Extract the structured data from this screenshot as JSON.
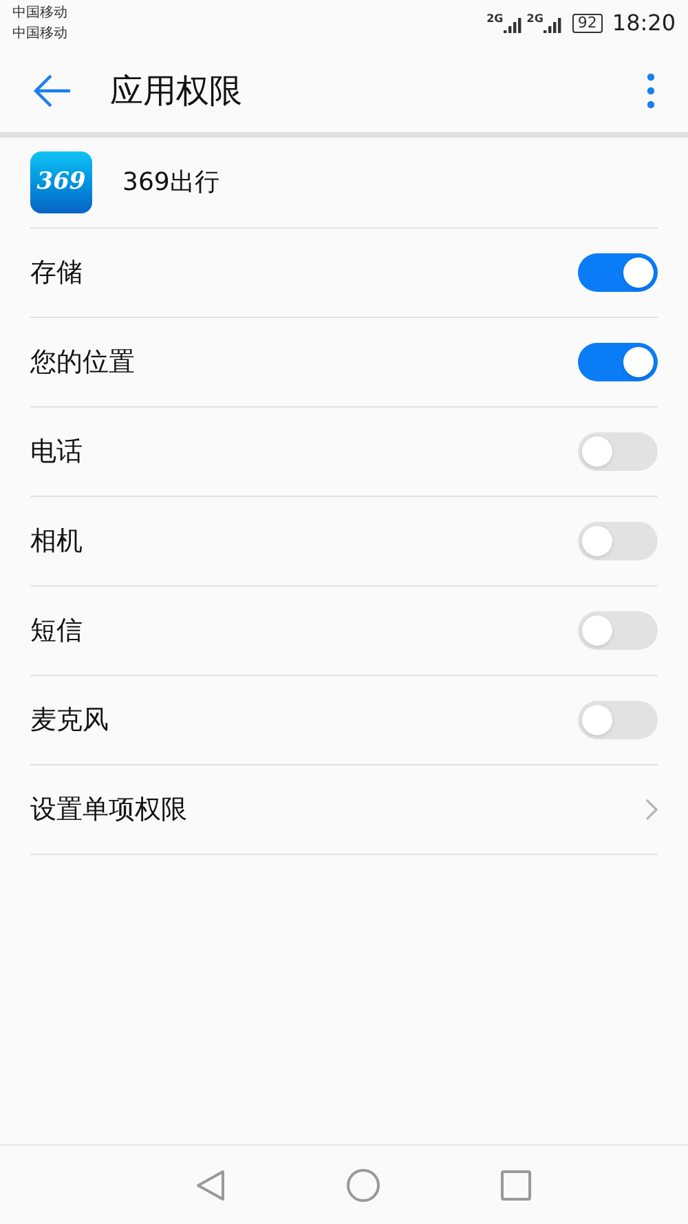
{
  "status_bar": {
    "carriers": [
      "中国移动",
      "中国移动"
    ],
    "network_labels": [
      "2G",
      "2G"
    ],
    "battery": "92",
    "time": "18:20"
  },
  "header": {
    "title": "应用权限"
  },
  "app": {
    "logo_text": "369",
    "name": "369出行"
  },
  "permissions": [
    {
      "kind": "toggle",
      "label": "存储",
      "on": true
    },
    {
      "kind": "toggle",
      "label": "您的位置",
      "on": true
    },
    {
      "kind": "toggle",
      "label": "电话",
      "on": false
    },
    {
      "kind": "toggle",
      "label": "相机",
      "on": false
    },
    {
      "kind": "toggle",
      "label": "短信",
      "on": false
    },
    {
      "kind": "toggle",
      "label": "麦克风",
      "on": false
    },
    {
      "kind": "link",
      "label": "设置单项权限"
    }
  ]
}
